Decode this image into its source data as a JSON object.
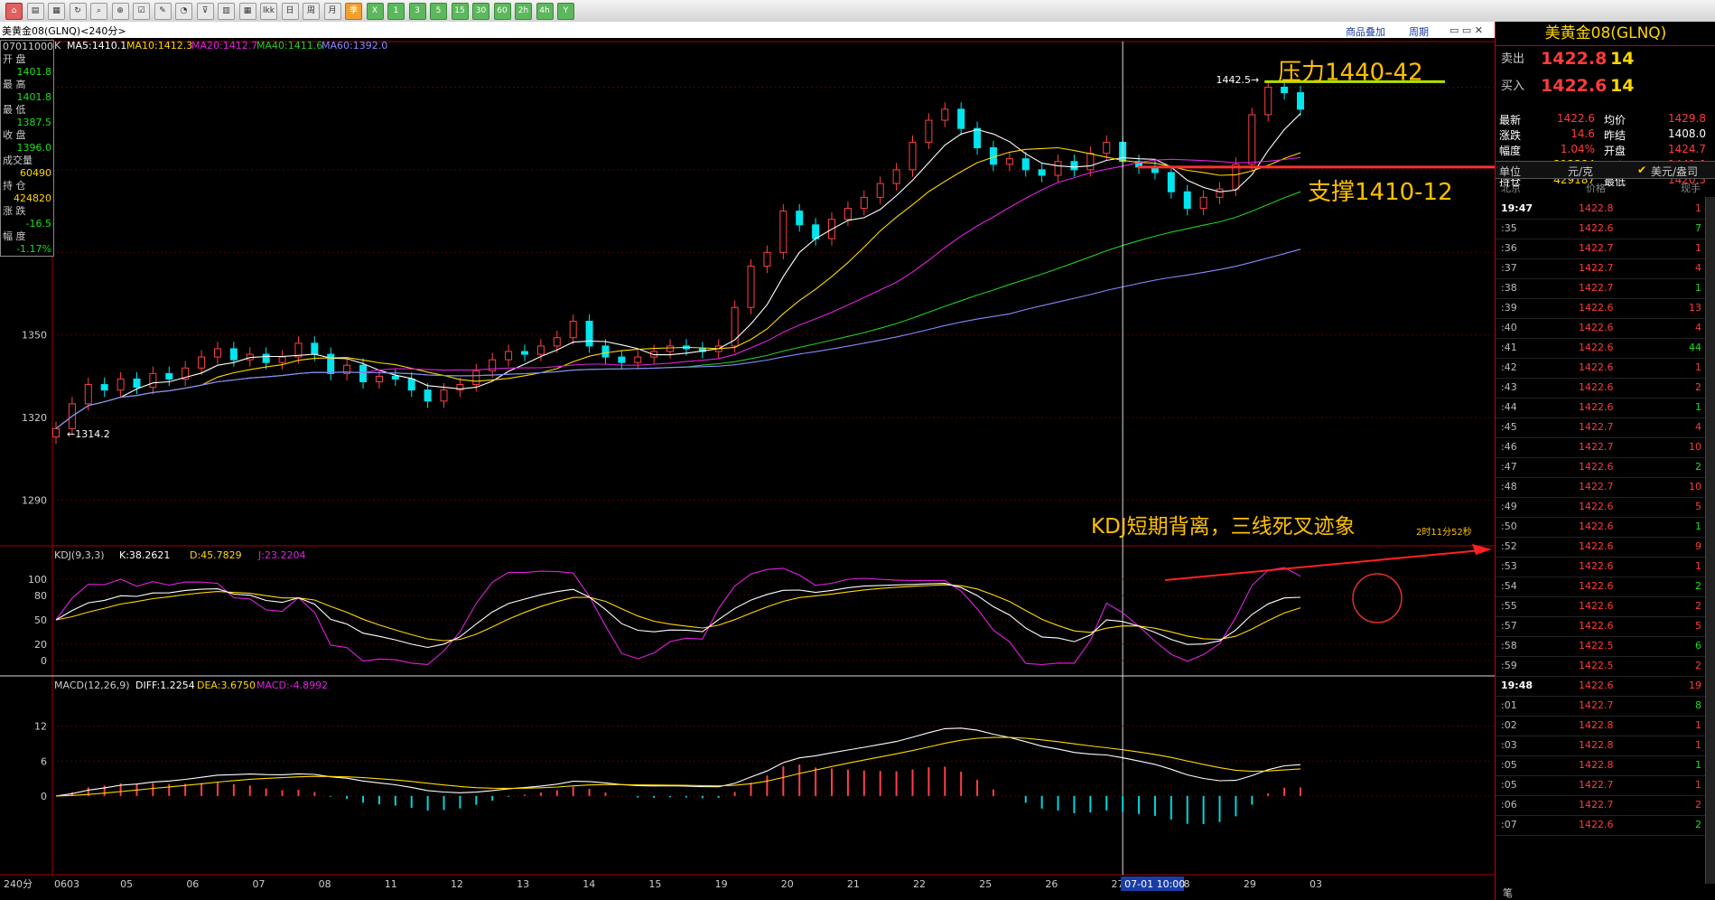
{
  "toolbar": {
    "icons": [
      "home-icon",
      "book-icon",
      "open-icon",
      "refresh-icon",
      "search-icon",
      "zoom-icon",
      "checklist-icon",
      "pen-icon",
      "gauge-icon",
      "filter-icon",
      "list-icon",
      "chart-icon",
      "lkk-icon",
      "day-icon",
      "week-icon",
      "month-icon",
      "season-icon",
      "x-icon",
      "one-min-icon",
      "three-min-icon",
      "five-min-icon",
      "fifteen-min-icon",
      "thirty-min-icon",
      "sixty-min-icon",
      "two-h-icon",
      "four-h-icon",
      "y-icon"
    ],
    "labels": {
      "lkk": "lkk",
      "day": "日",
      "week": "周",
      "month": "月",
      "season": "季",
      "x": "X",
      "m1": "1",
      "m3": "3",
      "m5": "5",
      "m15": "15",
      "m30": "30",
      "m60": "60",
      "h2": "2h",
      "h4": "4h",
      "y": "Y"
    }
  },
  "title": "美黄金08(GLNQ)<240分>",
  "links": {
    "overlay": "商品叠加",
    "period": "周期"
  },
  "ma_legend": {
    "k": "K",
    "ma5": "MA5:1410.1",
    "ma10": "MA10:1412.3",
    "ma20": "MA20:1412.7",
    "ma40": "MA40:1411.6",
    "ma60": "MA60:1392.0"
  },
  "info_box": {
    "date": "07011000",
    "open_l": "开 盘",
    "open": "1401.8",
    "high_l": "最 高",
    "high": "1401.8",
    "low_l": "最 低",
    "low": "1387.5",
    "close_l": "收 盘",
    "close": "1396.0",
    "vol_l": "成交量",
    "vol": "60490",
    "oi_l": "持 仓",
    "oi": "424820",
    "chg_l": "涨 跌",
    "chg": "-16.5",
    "pct_l": "幅 度",
    "pct": "-1.17%"
  },
  "price_axis": [
    "1350",
    "1320",
    "1290"
  ],
  "price_marks": {
    "high": "1442.5",
    "low": "1314.2"
  },
  "annotations": {
    "resistance": "压力1440-42",
    "support": "支撑1410-12",
    "kdj_note": "KDJ短期背离，三线死叉迹象",
    "timer": "2时11分52秒"
  },
  "kdj_legend": {
    "name": "KDJ(9,3,3)",
    "k": "K:38.2621",
    "d": "D:45.7829",
    "j": "J:23.2204"
  },
  "kdj_axis": [
    "100",
    "80",
    "50",
    "20",
    "0"
  ],
  "macd_legend": {
    "name": "MACD(12,26,9)",
    "diff": "DIFF:1.2254",
    "dea": "DEA:3.6750",
    "macd": "MACD:-4.8992"
  },
  "macd_axis": [
    "12",
    "6",
    "0"
  ],
  "x_axis": {
    "corner": "240分",
    "labels": [
      "0603",
      "05",
      "06",
      "07",
      "08",
      "11",
      "12",
      "13",
      "14",
      "15",
      "19",
      "20",
      "21",
      "22",
      "25",
      "26",
      "27",
      "28",
      "29",
      "03"
    ],
    "cursor": "07-01 10:00"
  },
  "right_panel": {
    "title": "美黄金08(GLNQ)",
    "sell_l": "卖出",
    "sell": "1422.8",
    "sell_q": "14",
    "buy_l": "买入",
    "buy": "1422.6",
    "buy_q": "14",
    "stats": [
      [
        "最新",
        "1422.6",
        "均价",
        "1429.8"
      ],
      [
        "涨跌",
        "14.6",
        "昨结",
        "1408.0"
      ],
      [
        "幅度",
        "1.04%",
        "开盘",
        "1424.7"
      ],
      [
        "总手",
        "212384",
        "最高",
        "1441.0"
      ],
      [
        "持仓",
        "429187",
        "最低",
        "1420.5"
      ]
    ],
    "unit_l": "单位",
    "unit": "元/克",
    "unit2": "美元/盎司",
    "cols": [
      "北京",
      "价格",
      "现手"
    ],
    "ticks": [
      [
        "19:47",
        "1422.8",
        "1"
      ],
      [
        ":35",
        "1422.6",
        "7"
      ],
      [
        ":36",
        "1422.7",
        "1"
      ],
      [
        ":37",
        "1422.7",
        "4"
      ],
      [
        ":38",
        "1422.7",
        "1"
      ],
      [
        ":39",
        "1422.6",
        "13"
      ],
      [
        ":40",
        "1422.6",
        "4"
      ],
      [
        ":41",
        "1422.6",
        "44"
      ],
      [
        ":42",
        "1422.6",
        "1"
      ],
      [
        ":43",
        "1422.6",
        "2"
      ],
      [
        ":44",
        "1422.6",
        "1"
      ],
      [
        ":45",
        "1422.7",
        "4"
      ],
      [
        ":46",
        "1422.7",
        "10"
      ],
      [
        ":47",
        "1422.6",
        "2"
      ],
      [
        ":48",
        "1422.7",
        "10"
      ],
      [
        ":49",
        "1422.6",
        "5"
      ],
      [
        ":50",
        "1422.6",
        "1"
      ],
      [
        ":52",
        "1422.6",
        "9"
      ],
      [
        ":53",
        "1422.6",
        "1"
      ],
      [
        ":54",
        "1422.6",
        "2"
      ],
      [
        ":55",
        "1422.6",
        "2"
      ],
      [
        ":57",
        "1422.6",
        "5"
      ],
      [
        ":58",
        "1422.5",
        "6"
      ],
      [
        ":59",
        "1422.5",
        "2"
      ],
      [
        "19:48",
        "1422.6",
        "19"
      ],
      [
        ":01",
        "1422.7",
        "8"
      ],
      [
        ":02",
        "1422.8",
        "1"
      ],
      [
        ":03",
        "1422.8",
        "1"
      ],
      [
        ":05",
        "1422.8",
        "1"
      ],
      [
        ":05",
        "1422.7",
        "1"
      ],
      [
        ":06",
        "1422.7",
        "2"
      ],
      [
        ":07",
        "1422.6",
        "2"
      ]
    ],
    "footer": "笔"
  },
  "chart_data": {
    "type": "candlestick",
    "price_range": [
      1280,
      1450
    ],
    "closes": [
      1316,
      1325,
      1332,
      1330,
      1334,
      1331,
      1336,
      1334,
      1338,
      1342,
      1345,
      1341,
      1343,
      1340,
      1342,
      1347,
      1343,
      1336,
      1339,
      1333,
      1335,
      1334,
      1330,
      1326,
      1330,
      1332,
      1337,
      1341,
      1344,
      1343,
      1346,
      1349,
      1355,
      1346,
      1342,
      1340,
      1342,
      1344,
      1346,
      1345,
      1344,
      1346,
      1360,
      1375,
      1380,
      1395,
      1390,
      1385,
      1392,
      1396,
      1400,
      1405,
      1410,
      1420,
      1428,
      1432,
      1425,
      1418,
      1412,
      1414,
      1410,
      1408,
      1413,
      1410,
      1416,
      1420,
      1413,
      1411,
      1409,
      1402,
      1396,
      1400,
      1403,
      1412,
      1430,
      1440,
      1438,
      1432
    ],
    "kdj": {
      "k_last": 38.2621,
      "d_last": 45.7829,
      "j_last": 23.2204
    },
    "macd": {
      "diff_last": 1.2254,
      "dea_last": 3.675,
      "macd_last": -4.8992
    }
  }
}
